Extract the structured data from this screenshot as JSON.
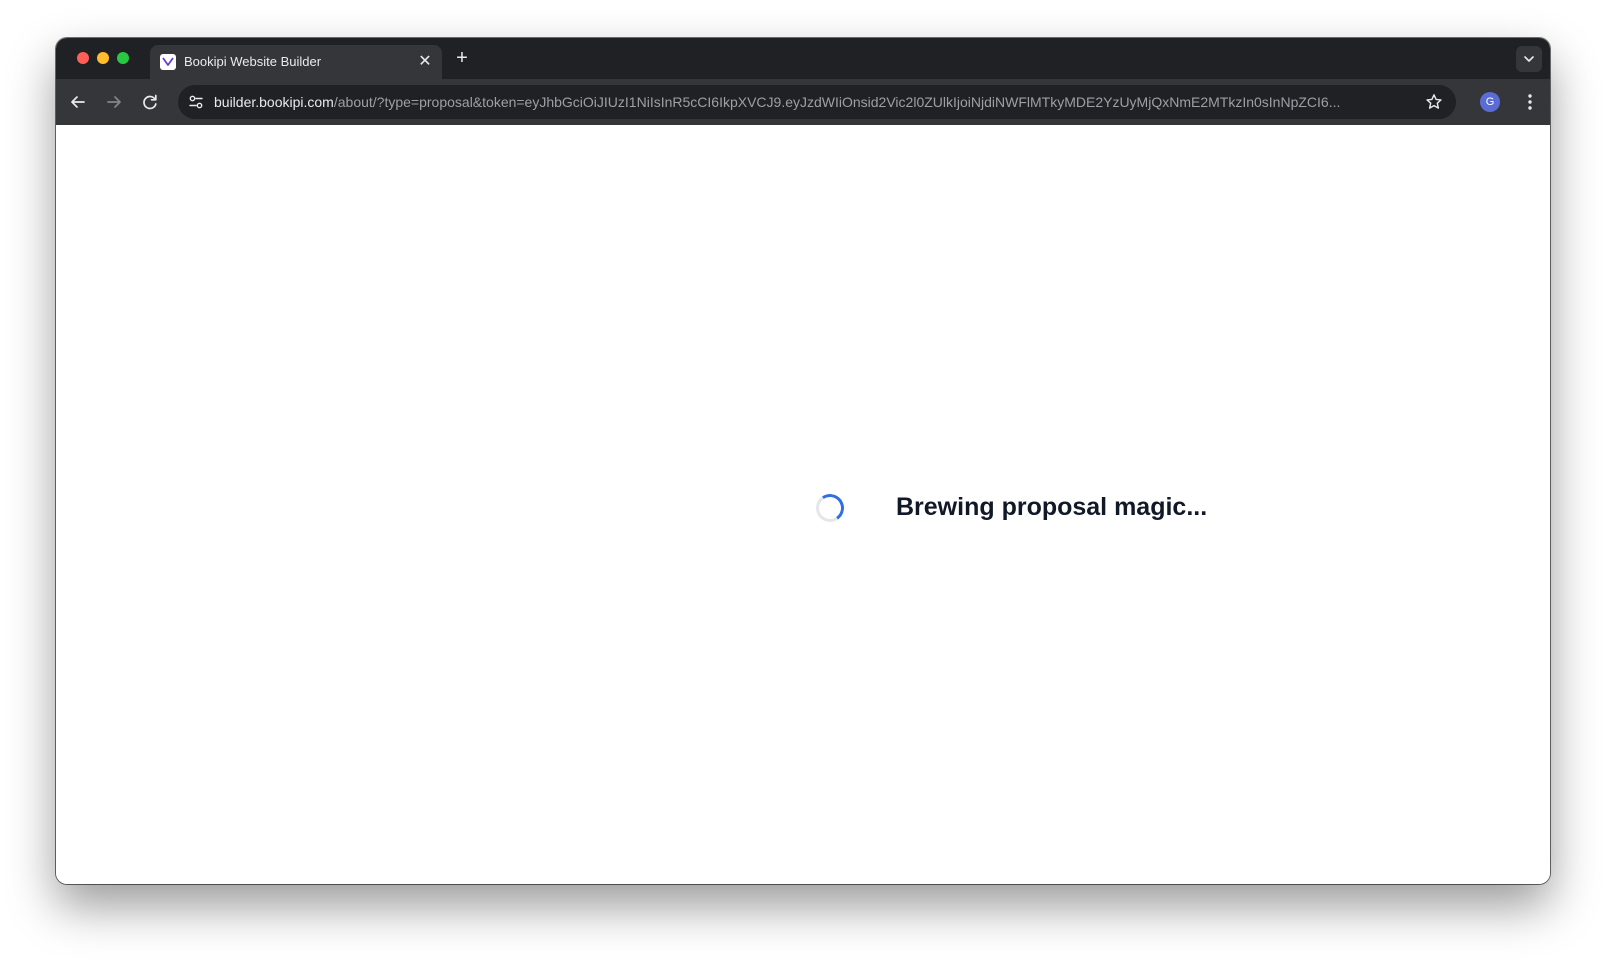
{
  "browser": {
    "tab": {
      "title": "Bookipi Website Builder",
      "close_glyph": "✕",
      "favicon": "bookipi-logo-icon"
    },
    "new_tab_glyph": "+",
    "address_bar": {
      "host": "builder.bookipi.com",
      "path": "/about/?type=proposal&token=eyJhbGciOiJIUzI1NiIsInR5cCI6IkpXVCJ9.eyJzdWIiOnsid2Vic2l0ZUlkIjoiNjdiNWFlMTkyMDE2YzUyMjQxNmE2MTkzIn0sInNpZCI6..."
    },
    "profile_initial": "G",
    "icons": {
      "back": "arrow-left-icon",
      "forward": "arrow-right-icon",
      "reload": "reload-icon",
      "site_info": "tune-icon",
      "bookmark": "star-icon",
      "menu": "more-vertical-icon",
      "tab_search": "chevron-down-icon"
    },
    "colors": {
      "frame": "#202124",
      "toolbar": "#35363a",
      "accent_spinner": "#2f6fe4",
      "avatar": "#5b6cd6"
    }
  },
  "page": {
    "loading_text": "Brewing proposal magic..."
  }
}
